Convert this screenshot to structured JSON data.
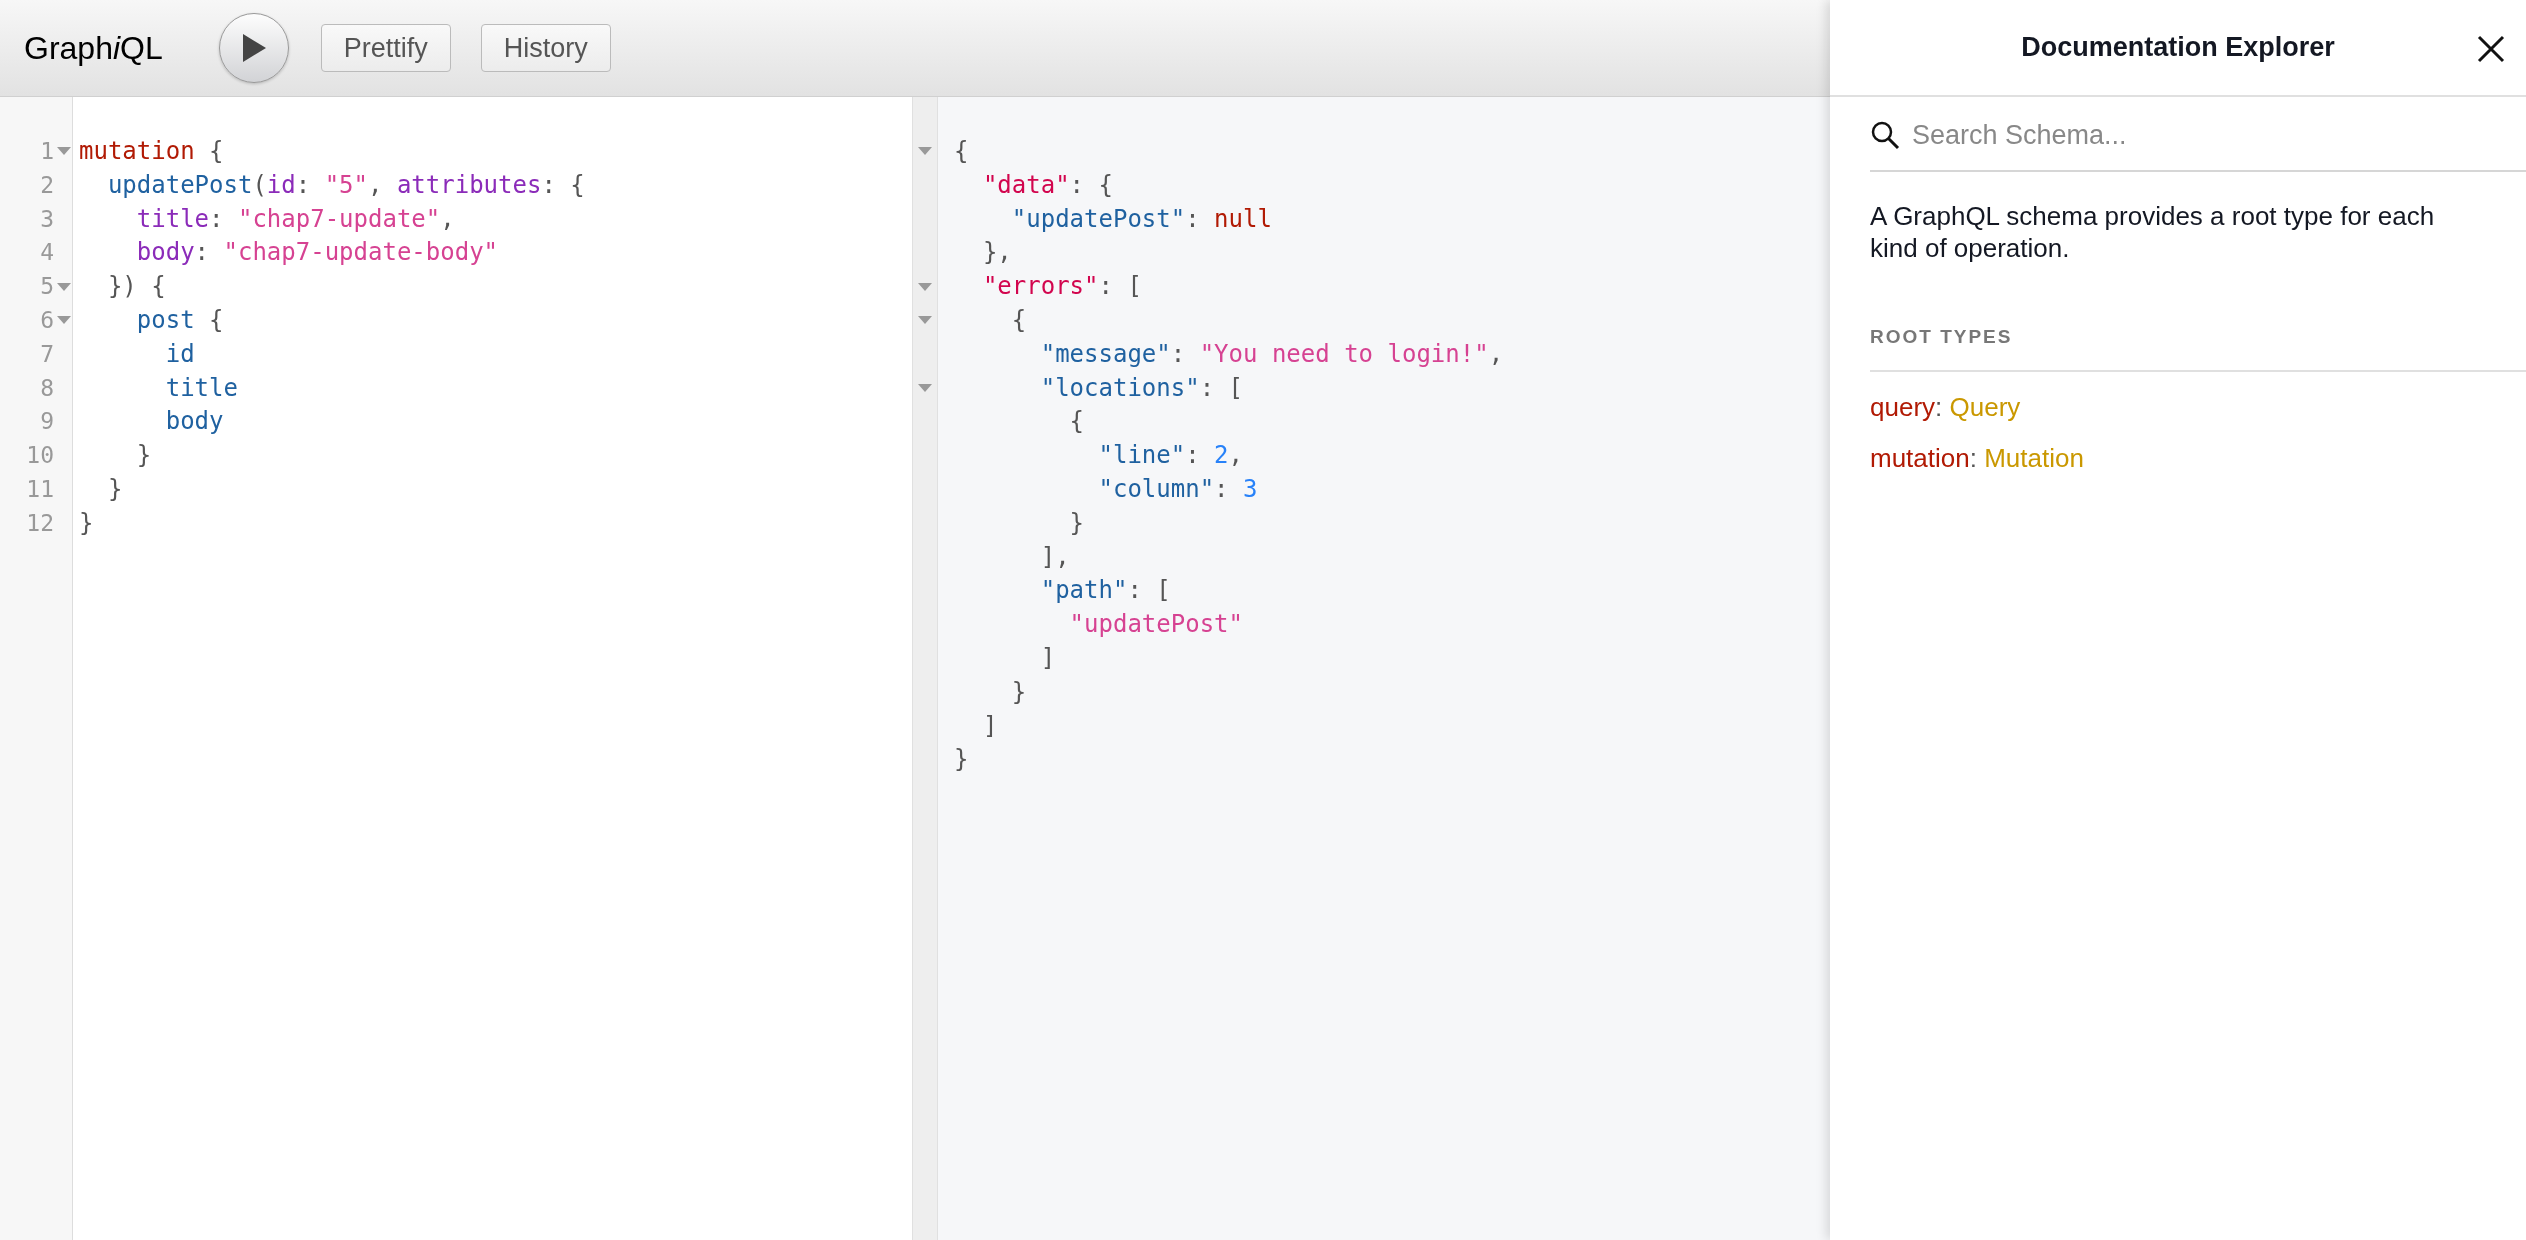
{
  "toolbar": {
    "logo": [
      {
        "text": "Graph",
        "italic": false
      },
      {
        "text": "i",
        "italic": true
      },
      {
        "text": "QL",
        "italic": false
      }
    ],
    "buttons": [
      {
        "label": "Prettify"
      },
      {
        "label": "History"
      }
    ]
  },
  "query_editor": {
    "lines": [
      {
        "number": "1",
        "foldable": true,
        "tokens": [
          {
            "text": "mutation",
            "kind": "keyword"
          },
          {
            "text": " {",
            "kind": "punctuation"
          }
        ]
      },
      {
        "number": "2",
        "foldable": false,
        "tokens": [
          {
            "text": "  updatePost",
            "kind": "field"
          },
          {
            "text": "(",
            "kind": "punctuation"
          },
          {
            "text": "id",
            "kind": "argument"
          },
          {
            "text": ": ",
            "kind": "punctuation"
          },
          {
            "text": "\"5\"",
            "kind": "string"
          },
          {
            "text": ", ",
            "kind": "punctuation"
          },
          {
            "text": "attributes",
            "kind": "argument"
          },
          {
            "text": ": {",
            "kind": "punctuation"
          }
        ]
      },
      {
        "number": "3",
        "foldable": false,
        "tokens": [
          {
            "text": "    title",
            "kind": "argument"
          },
          {
            "text": ": ",
            "kind": "punctuation"
          },
          {
            "text": "\"chap7-update\"",
            "kind": "string"
          },
          {
            "text": ",",
            "kind": "punctuation"
          }
        ]
      },
      {
        "number": "4",
        "foldable": false,
        "tokens": [
          {
            "text": "    body",
            "kind": "argument"
          },
          {
            "text": ": ",
            "kind": "punctuation"
          },
          {
            "text": "\"chap7-update-body\"",
            "kind": "string"
          }
        ]
      },
      {
        "number": "5",
        "foldable": true,
        "tokens": [
          {
            "text": "  }) {",
            "kind": "punctuation"
          }
        ]
      },
      {
        "number": "6",
        "foldable": true,
        "tokens": [
          {
            "text": "    post",
            "kind": "field"
          },
          {
            "text": " {",
            "kind": "punctuation"
          }
        ]
      },
      {
        "number": "7",
        "foldable": false,
        "tokens": [
          {
            "text": "      id",
            "kind": "field"
          }
        ]
      },
      {
        "number": "8",
        "foldable": false,
        "tokens": [
          {
            "text": "      title",
            "kind": "field"
          }
        ]
      },
      {
        "number": "9",
        "foldable": false,
        "tokens": [
          {
            "text": "      body",
            "kind": "field"
          }
        ]
      },
      {
        "number": "10",
        "foldable": false,
        "tokens": [
          {
            "text": "    }",
            "kind": "punctuation"
          }
        ]
      },
      {
        "number": "11",
        "foldable": false,
        "tokens": [
          {
            "text": "  }",
            "kind": "punctuation"
          }
        ]
      },
      {
        "number": "12",
        "foldable": false,
        "tokens": [
          {
            "text": "}",
            "kind": "punctuation"
          }
        ]
      }
    ]
  },
  "result_viewer": {
    "lines": [
      {
        "foldable": true,
        "tokens": [
          {
            "text": "{",
            "kind": "punctuation"
          }
        ]
      },
      {
        "foldable": false,
        "tokens": [
          {
            "text": "  \"data\"",
            "kind": "top-key"
          },
          {
            "text": ": {",
            "kind": "punctuation"
          }
        ]
      },
      {
        "foldable": false,
        "tokens": [
          {
            "text": "    \"updatePost\"",
            "kind": "key"
          },
          {
            "text": ": ",
            "kind": "punctuation"
          },
          {
            "text": "null",
            "kind": "atom"
          }
        ]
      },
      {
        "foldable": false,
        "tokens": [
          {
            "text": "  },",
            "kind": "punctuation"
          }
        ]
      },
      {
        "foldable": true,
        "tokens": [
          {
            "text": "  \"errors\"",
            "kind": "top-key"
          },
          {
            "text": ": [",
            "kind": "punctuation"
          }
        ]
      },
      {
        "foldable": true,
        "tokens": [
          {
            "text": "    {",
            "kind": "punctuation"
          }
        ]
      },
      {
        "foldable": false,
        "tokens": [
          {
            "text": "      \"message\"",
            "kind": "key"
          },
          {
            "text": ": ",
            "kind": "punctuation"
          },
          {
            "text": "\"You need to login!\"",
            "kind": "string"
          },
          {
            "text": ",",
            "kind": "punctuation"
          }
        ]
      },
      {
        "foldable": true,
        "tokens": [
          {
            "text": "      \"locations\"",
            "kind": "key"
          },
          {
            "text": ": [",
            "kind": "punctuation"
          }
        ]
      },
      {
        "foldable": false,
        "tokens": [
          {
            "text": "        {",
            "kind": "punctuation"
          }
        ]
      },
      {
        "foldable": false,
        "tokens": [
          {
            "text": "          \"line\"",
            "kind": "key"
          },
          {
            "text": ": ",
            "kind": "punctuation"
          },
          {
            "text": "2",
            "kind": "number"
          },
          {
            "text": ",",
            "kind": "punctuation"
          }
        ]
      },
      {
        "foldable": false,
        "tokens": [
          {
            "text": "          \"column\"",
            "kind": "key"
          },
          {
            "text": ": ",
            "kind": "punctuation"
          },
          {
            "text": "3",
            "kind": "number"
          }
        ]
      },
      {
        "foldable": false,
        "tokens": [
          {
            "text": "        }",
            "kind": "punctuation"
          }
        ]
      },
      {
        "foldable": false,
        "tokens": [
          {
            "text": "      ],",
            "kind": "punctuation"
          }
        ]
      },
      {
        "foldable": false,
        "tokens": [
          {
            "text": "      \"path\"",
            "kind": "key"
          },
          {
            "text": ": [",
            "kind": "punctuation"
          }
        ]
      },
      {
        "foldable": false,
        "tokens": [
          {
            "text": "        \"updatePost\"",
            "kind": "string"
          }
        ]
      },
      {
        "foldable": false,
        "tokens": [
          {
            "text": "      ]",
            "kind": "punctuation"
          }
        ]
      },
      {
        "foldable": false,
        "tokens": [
          {
            "text": "    }",
            "kind": "punctuation"
          }
        ]
      },
      {
        "foldable": false,
        "tokens": [
          {
            "text": "  ]",
            "kind": "punctuation"
          }
        ]
      },
      {
        "foldable": false,
        "tokens": [
          {
            "text": "}",
            "kind": "punctuation"
          }
        ]
      }
    ]
  },
  "documentation_explorer": {
    "title": "Documentation Explorer",
    "search": {
      "placeholder": "Search Schema..."
    },
    "description": "A GraphQL schema provides a root type for each kind of operation.",
    "section_title": "ROOT TYPES",
    "root_types": [
      {
        "tokens": [
          {
            "text": "query",
            "kind": "field-name"
          },
          {
            "text": ": ",
            "kind": "punctuation"
          },
          {
            "text": "Query",
            "kind": "type-name"
          }
        ]
      },
      {
        "tokens": [
          {
            "text": "mutation",
            "kind": "field-name"
          },
          {
            "text": ": ",
            "kind": "punctuation"
          },
          {
            "text": "Mutation",
            "kind": "type-name"
          }
        ]
      }
    ]
  }
}
